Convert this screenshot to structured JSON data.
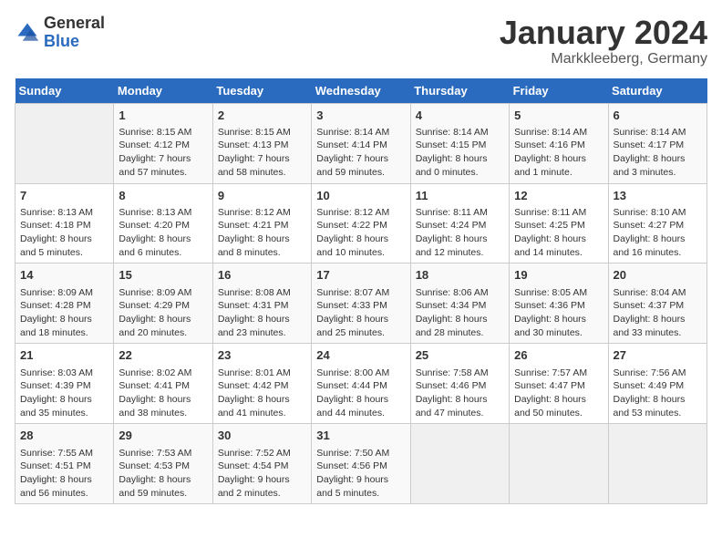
{
  "logo": {
    "general": "General",
    "blue": "Blue"
  },
  "title": "January 2024",
  "subtitle": "Markkleeberg, Germany",
  "weekdays": [
    "Sunday",
    "Monday",
    "Tuesday",
    "Wednesday",
    "Thursday",
    "Friday",
    "Saturday"
  ],
  "weeks": [
    [
      {
        "day": "",
        "sunrise": "",
        "sunset": "",
        "daylight": "",
        "empty": true
      },
      {
        "day": "1",
        "sunrise": "8:15 AM",
        "sunset": "4:12 PM",
        "daylight": "7 hours and 57 minutes."
      },
      {
        "day": "2",
        "sunrise": "8:15 AM",
        "sunset": "4:13 PM",
        "daylight": "7 hours and 58 minutes."
      },
      {
        "day": "3",
        "sunrise": "8:14 AM",
        "sunset": "4:14 PM",
        "daylight": "7 hours and 59 minutes."
      },
      {
        "day": "4",
        "sunrise": "8:14 AM",
        "sunset": "4:15 PM",
        "daylight": "8 hours and 0 minutes."
      },
      {
        "day": "5",
        "sunrise": "8:14 AM",
        "sunset": "4:16 PM",
        "daylight": "8 hours and 1 minute."
      },
      {
        "day": "6",
        "sunrise": "8:14 AM",
        "sunset": "4:17 PM",
        "daylight": "8 hours and 3 minutes."
      }
    ],
    [
      {
        "day": "7",
        "sunrise": "8:13 AM",
        "sunset": "4:18 PM",
        "daylight": "8 hours and 5 minutes."
      },
      {
        "day": "8",
        "sunrise": "8:13 AM",
        "sunset": "4:20 PM",
        "daylight": "8 hours and 6 minutes."
      },
      {
        "day": "9",
        "sunrise": "8:12 AM",
        "sunset": "4:21 PM",
        "daylight": "8 hours and 8 minutes."
      },
      {
        "day": "10",
        "sunrise": "8:12 AM",
        "sunset": "4:22 PM",
        "daylight": "8 hours and 10 minutes."
      },
      {
        "day": "11",
        "sunrise": "8:11 AM",
        "sunset": "4:24 PM",
        "daylight": "8 hours and 12 minutes."
      },
      {
        "day": "12",
        "sunrise": "8:11 AM",
        "sunset": "4:25 PM",
        "daylight": "8 hours and 14 minutes."
      },
      {
        "day": "13",
        "sunrise": "8:10 AM",
        "sunset": "4:27 PM",
        "daylight": "8 hours and 16 minutes."
      }
    ],
    [
      {
        "day": "14",
        "sunrise": "8:09 AM",
        "sunset": "4:28 PM",
        "daylight": "8 hours and 18 minutes."
      },
      {
        "day": "15",
        "sunrise": "8:09 AM",
        "sunset": "4:29 PM",
        "daylight": "8 hours and 20 minutes."
      },
      {
        "day": "16",
        "sunrise": "8:08 AM",
        "sunset": "4:31 PM",
        "daylight": "8 hours and 23 minutes."
      },
      {
        "day": "17",
        "sunrise": "8:07 AM",
        "sunset": "4:33 PM",
        "daylight": "8 hours and 25 minutes."
      },
      {
        "day": "18",
        "sunrise": "8:06 AM",
        "sunset": "4:34 PM",
        "daylight": "8 hours and 28 minutes."
      },
      {
        "day": "19",
        "sunrise": "8:05 AM",
        "sunset": "4:36 PM",
        "daylight": "8 hours and 30 minutes."
      },
      {
        "day": "20",
        "sunrise": "8:04 AM",
        "sunset": "4:37 PM",
        "daylight": "8 hours and 33 minutes."
      }
    ],
    [
      {
        "day": "21",
        "sunrise": "8:03 AM",
        "sunset": "4:39 PM",
        "daylight": "8 hours and 35 minutes."
      },
      {
        "day": "22",
        "sunrise": "8:02 AM",
        "sunset": "4:41 PM",
        "daylight": "8 hours and 38 minutes."
      },
      {
        "day": "23",
        "sunrise": "8:01 AM",
        "sunset": "4:42 PM",
        "daylight": "8 hours and 41 minutes."
      },
      {
        "day": "24",
        "sunrise": "8:00 AM",
        "sunset": "4:44 PM",
        "daylight": "8 hours and 44 minutes."
      },
      {
        "day": "25",
        "sunrise": "7:58 AM",
        "sunset": "4:46 PM",
        "daylight": "8 hours and 47 minutes."
      },
      {
        "day": "26",
        "sunrise": "7:57 AM",
        "sunset": "4:47 PM",
        "daylight": "8 hours and 50 minutes."
      },
      {
        "day": "27",
        "sunrise": "7:56 AM",
        "sunset": "4:49 PM",
        "daylight": "8 hours and 53 minutes."
      }
    ],
    [
      {
        "day": "28",
        "sunrise": "7:55 AM",
        "sunset": "4:51 PM",
        "daylight": "8 hours and 56 minutes."
      },
      {
        "day": "29",
        "sunrise": "7:53 AM",
        "sunset": "4:53 PM",
        "daylight": "8 hours and 59 minutes."
      },
      {
        "day": "30",
        "sunrise": "7:52 AM",
        "sunset": "4:54 PM",
        "daylight": "9 hours and 2 minutes."
      },
      {
        "day": "31",
        "sunrise": "7:50 AM",
        "sunset": "4:56 PM",
        "daylight": "9 hours and 5 minutes."
      },
      {
        "day": "",
        "empty": true
      },
      {
        "day": "",
        "empty": true
      },
      {
        "day": "",
        "empty": true
      }
    ]
  ]
}
